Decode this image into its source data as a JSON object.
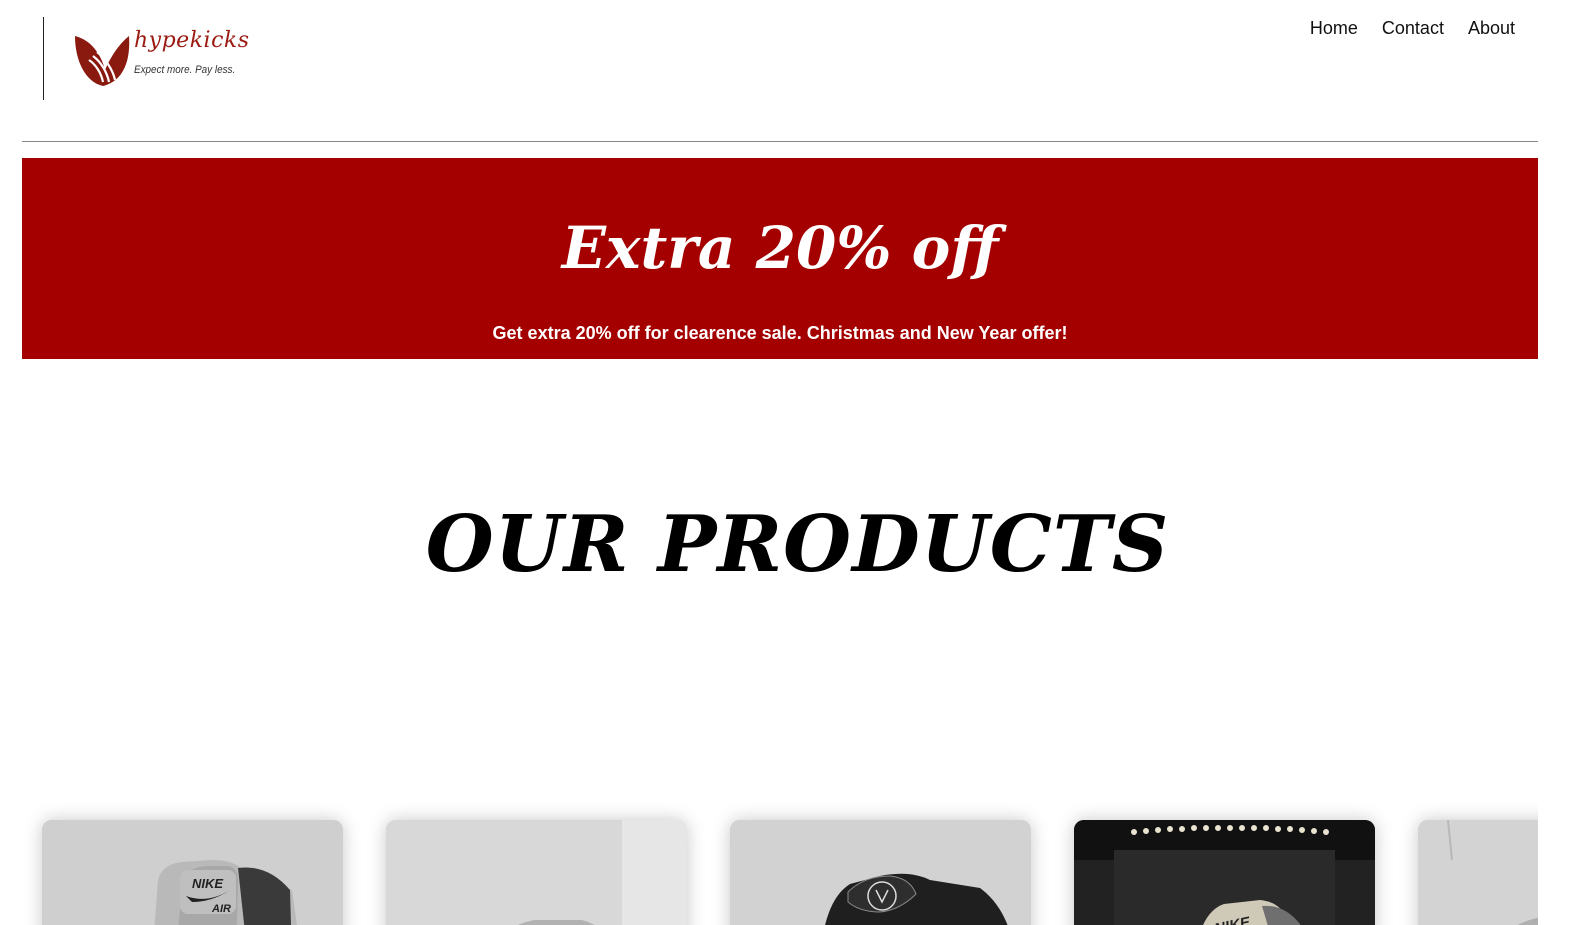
{
  "brand": {
    "name": "hypekicks",
    "tagline": "Expect more. Pay less.",
    "color": "#9b1a12"
  },
  "nav": {
    "items": [
      {
        "label": "Home"
      },
      {
        "label": "Contact"
      },
      {
        "label": "About"
      }
    ]
  },
  "banner": {
    "title": "Extra 20% off",
    "subtitle": "Get extra 20% off for clearence sale. Christmas and New Year offer!",
    "background": "#a40000"
  },
  "section": {
    "title": "OUR PRODUCTS"
  },
  "products": {
    "cards": [
      {
        "image": "sneaker-photo-nike-air-grey"
      },
      {
        "image": "sneaker-photo-grey-black"
      },
      {
        "image": "sneaker-photo-air-jordan-black"
      },
      {
        "image": "sneaker-photo-nike-grey-studio"
      },
      {
        "image": "sneaker-photo-partial"
      }
    ]
  }
}
